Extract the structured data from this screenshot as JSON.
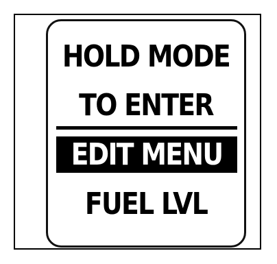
{
  "screen": {
    "line1": "HOLD MODE",
    "line2": "TO ENTER",
    "highlighted": "EDIT MENU",
    "line4": "FUEL LVL"
  },
  "colors": {
    "background": "#ffffff",
    "text": "#000000",
    "highlight_bg": "#000000",
    "highlight_text": "#ffffff"
  }
}
